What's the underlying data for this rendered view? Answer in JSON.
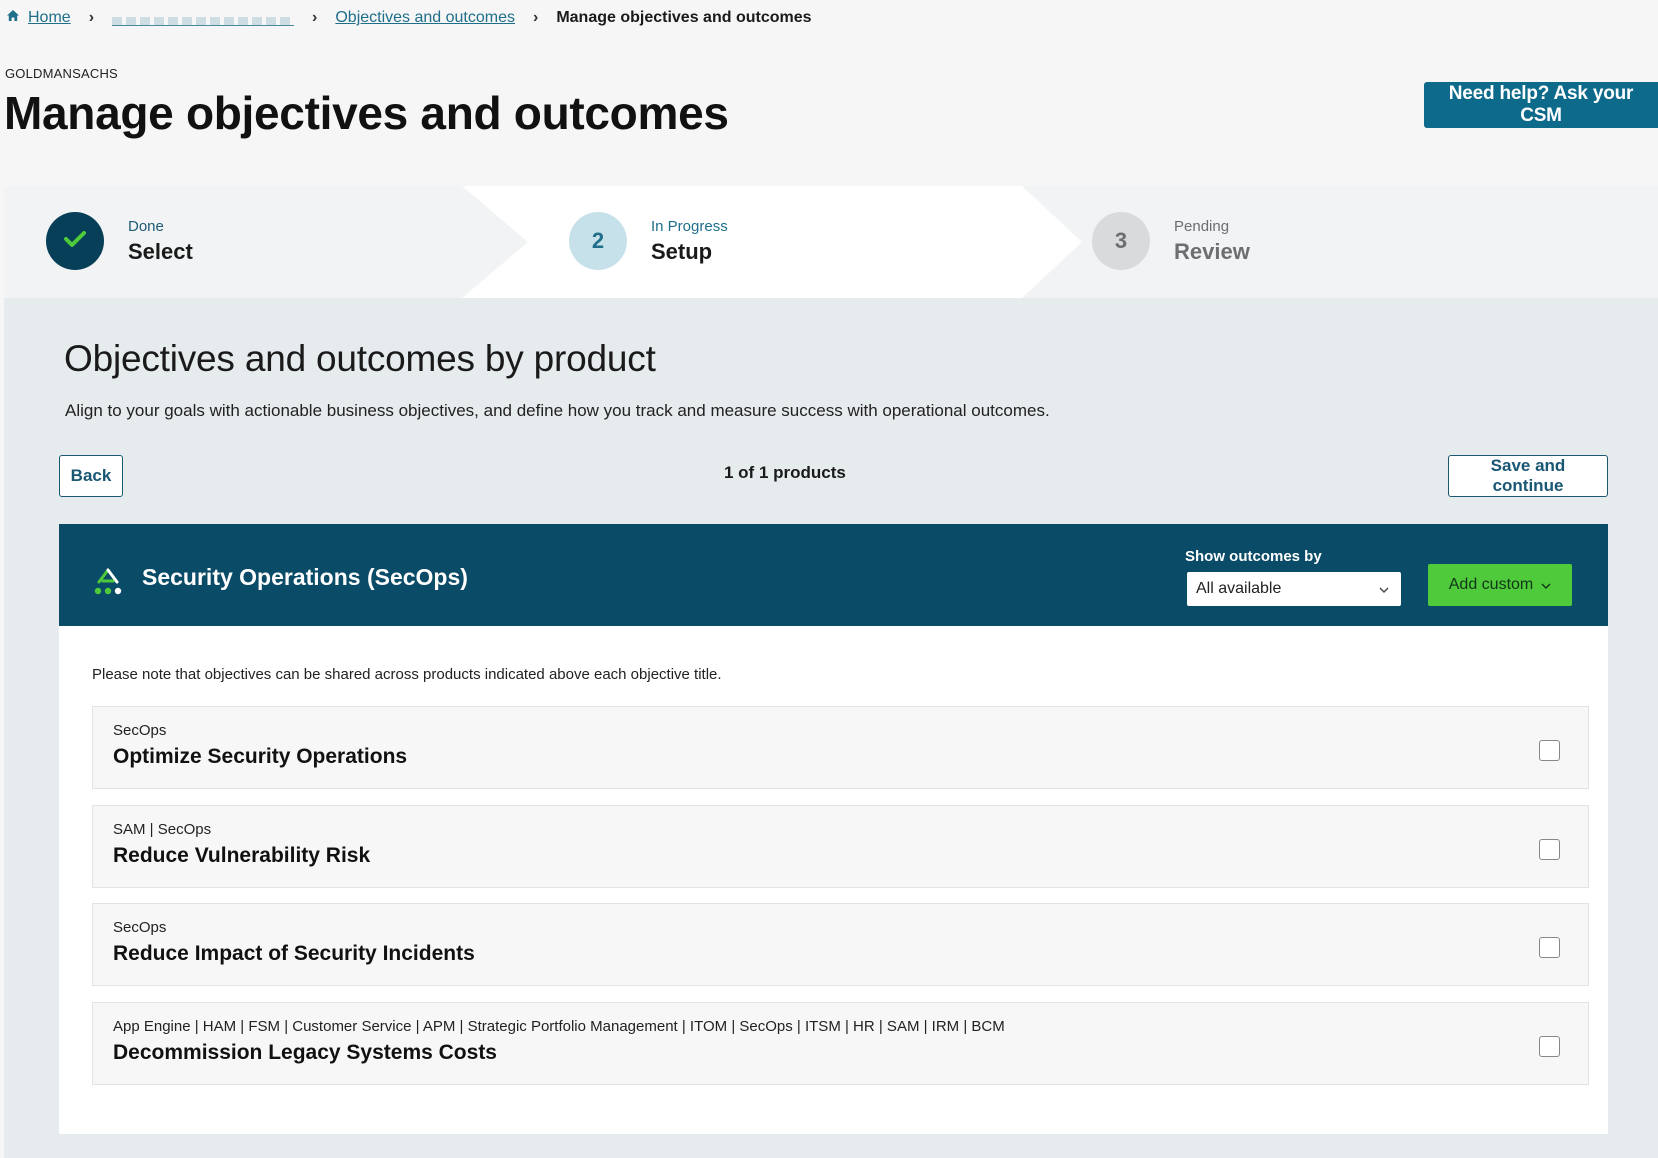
{
  "breadcrumb": {
    "home": "Home",
    "objectives": "Objectives and outcomes",
    "current": "Manage objectives and outcomes"
  },
  "header": {
    "company": "GOLDMANSACHS",
    "title": "Manage objectives and outcomes",
    "help_button": "Need help? Ask your CSM"
  },
  "stepper": {
    "steps": [
      {
        "status": "Done",
        "label": "Select",
        "number": ""
      },
      {
        "status": "In Progress",
        "label": "Setup",
        "number": "2"
      },
      {
        "status": "Pending",
        "label": "Review",
        "number": "3"
      }
    ]
  },
  "main": {
    "title": "Objectives and outcomes by product",
    "description": "Align to your goals with actionable business objectives, and define how you track and measure success with operational outcomes.",
    "back_button": "Back",
    "count": "1 of 1 products",
    "save_button": "Save and continue"
  },
  "product": {
    "name": "Security Operations (SecOps)",
    "show_label": "Show outcomes by",
    "show_value": "All available",
    "add_custom": "Add custom",
    "note": "Please note that objectives can be shared across products indicated above each objective title."
  },
  "objectives": [
    {
      "tags": "SecOps",
      "title": "Optimize Security Operations",
      "checked": false
    },
    {
      "tags": "SAM | SecOps",
      "title": "Reduce Vulnerability Risk",
      "checked": false
    },
    {
      "tags": "SecOps",
      "title": "Reduce Impact of Security Incidents",
      "checked": false
    },
    {
      "tags": "App Engine | HAM | FSM | Customer Service | APM | Strategic Portfolio Management | ITOM | SecOps | ITSM | HR | SAM | IRM | BCM",
      "title": "Decommission Legacy Systems Costs",
      "checked": false
    }
  ],
  "colors": {
    "brand_dark": "#0a4b67",
    "accent": "#0e6a8a",
    "add_button": "#4fca3a"
  }
}
